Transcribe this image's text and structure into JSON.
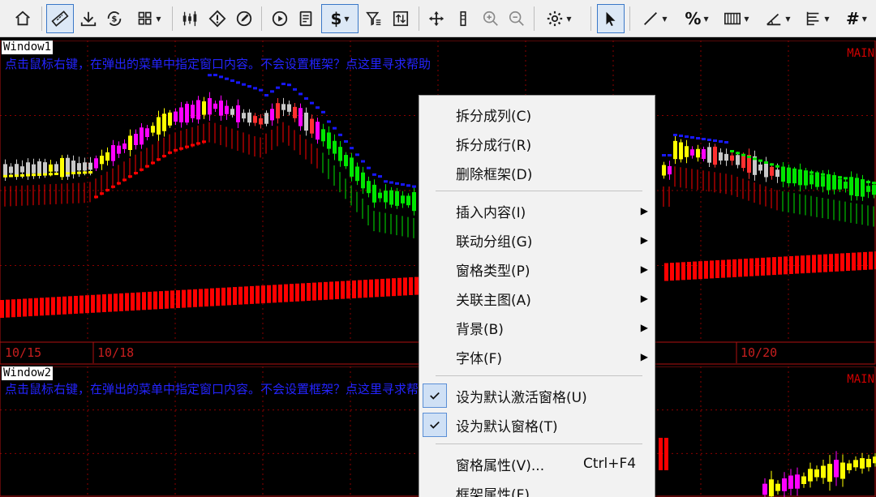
{
  "toolbar": {
    "dollar_symbol": "$",
    "percent_symbol": "%",
    "grid_symbol": "#"
  },
  "window1": {
    "label": "Window1",
    "hint": "点击鼠标右键，在弹出的菜单中指定窗口内容。不会设置框架？点这里寻求帮助",
    "main_label": "MAIN",
    "dates": [
      "10/15",
      "10/18",
      "10/20"
    ]
  },
  "window2": {
    "label": "Window2",
    "hint": "点击鼠标右键，在弹出的菜单中指定窗口内容。不会设置框架？点这里寻求帮助",
    "main_label": "MAIN"
  },
  "context_menu": {
    "items": [
      {
        "label": "拆分成列(C)"
      },
      {
        "label": "拆分成行(R)"
      },
      {
        "label": "删除框架(D)"
      },
      {
        "label": "插入内容(I)",
        "submenu": true
      },
      {
        "label": "联动分组(G)",
        "submenu": true
      },
      {
        "label": "窗格类型(P)",
        "submenu": true
      },
      {
        "label": "关联主图(A)",
        "submenu": true
      },
      {
        "label": "背景(B)",
        "submenu": true
      },
      {
        "label": "字体(F)",
        "submenu": true
      },
      {
        "label": "设为默认激活窗格(U)",
        "checked": true
      },
      {
        "label": "设为默认窗格(T)",
        "checked": true
      },
      {
        "label": "窗格属性(V)...",
        "shortcut": "Ctrl+F4"
      },
      {
        "label": "框架属性(F)..."
      }
    ]
  },
  "colors": {
    "up_candle": "#ff00ff",
    "yellow_candle": "#ffff00",
    "down_candle": "#00e600",
    "blue_dot": "#1818ff",
    "red_bar": "#ff0000",
    "grid_line": "#8a0000",
    "hint_text": "#2424ff"
  }
}
